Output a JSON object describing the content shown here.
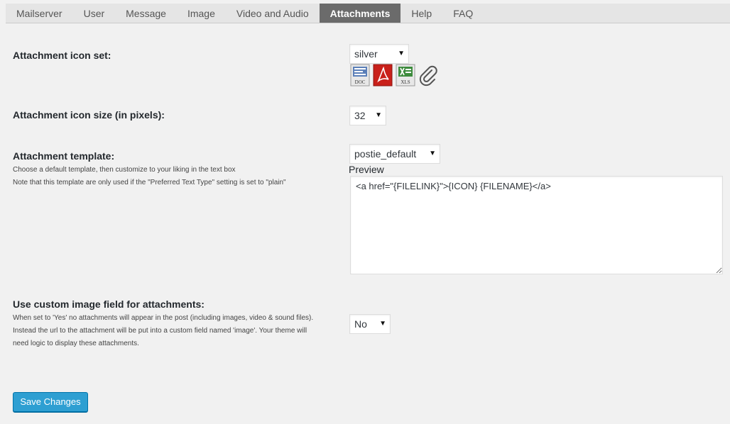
{
  "tabs": [
    "Mailserver",
    "User",
    "Message",
    "Image",
    "Video and Audio",
    "Attachments",
    "Help",
    "FAQ"
  ],
  "active_tab": "Attachments",
  "icon_set": {
    "label": "Attachment icon set:",
    "value": "silver",
    "icons": [
      "doc-icon",
      "pdf-icon",
      "xls-icon",
      "paperclip-icon"
    ],
    "icon_text": {
      "doc": "DOC",
      "xls": "XLS"
    }
  },
  "icon_size": {
    "label": "Attachment icon size (in pixels):",
    "value": "32"
  },
  "template": {
    "label": "Attachment template:",
    "desc1": "Choose a default template, then customize to your liking in the text box",
    "desc2": "Note that this template are only used if the \"Preferred Text Type\" setting is set to \"plain\"",
    "value": "postie_default",
    "preview_label": "Preview",
    "preview_text": "<a href=\"{FILELINK}\">{ICON} {FILENAME}</a>"
  },
  "custom_field": {
    "label": "Use custom image field for attachments:",
    "desc1": "When set to 'Yes' no attachments will appear in the post (including images, video & sound files).",
    "desc2": "Instead the url to the attachment will be put into a custom field named 'image'. Your theme will",
    "desc3": "need logic to display these attachments.",
    "value": "No"
  },
  "save_label": "Save Changes",
  "colors": {
    "accent": "#2e9fd2",
    "active_tab": "#6b6b6b",
    "background": "#f1f1f1"
  }
}
